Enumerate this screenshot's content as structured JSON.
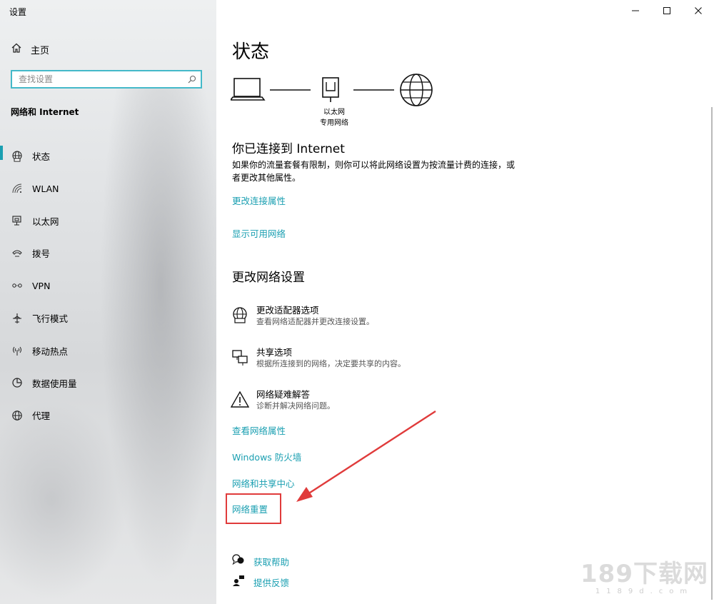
{
  "window": {
    "title": "设置"
  },
  "sidebar": {
    "home_label": "主页",
    "search_placeholder": "查找设置",
    "section_title": "网络和 Internet",
    "items": [
      {
        "label": "状态",
        "icon": "globe-status-icon",
        "selected": true
      },
      {
        "label": "WLAN",
        "icon": "wifi-icon",
        "selected": false
      },
      {
        "label": "以太网",
        "icon": "ethernet-icon",
        "selected": false
      },
      {
        "label": "拨号",
        "icon": "dialup-icon",
        "selected": false
      },
      {
        "label": "VPN",
        "icon": "vpn-icon",
        "selected": false
      },
      {
        "label": "飞行模式",
        "icon": "airplane-icon",
        "selected": false
      },
      {
        "label": "移动热点",
        "icon": "hotspot-icon",
        "selected": false
      },
      {
        "label": "数据使用量",
        "icon": "data-usage-icon",
        "selected": false
      },
      {
        "label": "代理",
        "icon": "proxy-globe-icon",
        "selected": false
      }
    ]
  },
  "main": {
    "title": "状态",
    "diagram": {
      "adapter_name": "以太网",
      "network_type": "专用网络"
    },
    "connected_heading": "你已连接到 Internet",
    "connected_desc": "如果你的流量套餐有限制，则你可以将此网络设置为按流量计费的连接，或者更改其他属性。",
    "links_top": [
      "更改连接属性",
      "显示可用网络"
    ],
    "change_heading": "更改网络设置",
    "options": [
      {
        "title": "更改适配器选项",
        "subtitle": "查看网络适配器并更改连接设置。",
        "icon": "adapter-globe-icon"
      },
      {
        "title": "共享选项",
        "subtitle": "根据所连接到的网络，决定要共享的内容。",
        "icon": "sharing-icon"
      },
      {
        "title": "网络疑难解答",
        "subtitle": "诊断并解决网络问题。",
        "icon": "warning-icon"
      }
    ],
    "links_bottom": [
      "查看网络属性",
      "Windows 防火墙",
      "网络和共享中心",
      "网络重置"
    ],
    "help": [
      "获取帮助",
      "提供反馈"
    ]
  },
  "watermark": {
    "main": "189下载网",
    "sub": "1189d.com"
  },
  "colors": {
    "accent": "#1a9fb1",
    "search_border": "#44b9c9",
    "annotation": "#e03b3b"
  }
}
